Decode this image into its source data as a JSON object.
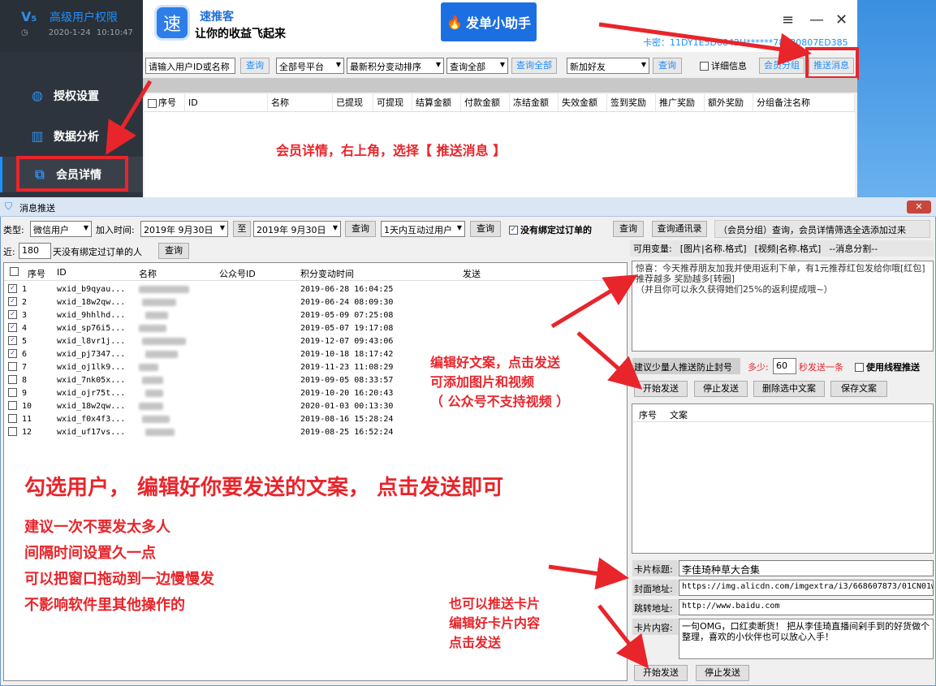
{
  "sidebar": {
    "logo_text": "V₅",
    "title": "高级用户权限",
    "date": "2020-1-24",
    "time": "10:10:47",
    "items": [
      {
        "label": "授权设置",
        "icon": "globe-icon"
      },
      {
        "label": "数据分析",
        "icon": "chart-icon"
      },
      {
        "label": "会员详情",
        "icon": "external-link-icon"
      }
    ]
  },
  "header": {
    "logo_char": "速",
    "app_name": "速推客",
    "slogan": "让你的收益飞起来",
    "helper_button": "发单小助手",
    "card_key": "卡密：11DY1E5D0842H******78630807ED385",
    "menu_icon": "≡",
    "minimize_icon": "—",
    "close_icon": "✕"
  },
  "member_toolbar": {
    "search_placeholder": "请输入用户ID或名称",
    "query_button": "查询",
    "platform_select": "全部号平台",
    "sort_select": "最新积分变动排序",
    "query_all_select": "查询全部",
    "query_all_button": "查询全部",
    "friend_select": "新加好友",
    "query_button2": "查询",
    "detail_checkbox": "详细信息",
    "member_group_button": "会员分组",
    "push_message_button": "推送消息"
  },
  "member_table": {
    "columns": [
      "序号",
      "ID",
      "名称",
      "已提现",
      "可提现",
      "结算金额",
      "付款金额",
      "冻结金额",
      "失效金额",
      "签到奖励",
      "推广奖励",
      "额外奖励",
      "分组备注名称"
    ]
  },
  "annotations": {
    "top": "会员详情，右上角，选择【 推送消息 】",
    "edit_1": "编辑好文案，点击发送",
    "edit_2": "可添加图片和视频",
    "edit_3": "（ 公众号不支持视频 ）",
    "main": "勾选用户，  编辑好你要发送的文案，  点击发送即可",
    "tip_1": "建议一次不要发太多人",
    "tip_2": "间隔时间设置久一点",
    "tip_3": "可以把窗口拖动到一边慢慢发",
    "tip_4": "不影响软件里其他操作的",
    "card_1": "也可以推送卡片",
    "card_2": "编辑好卡片内容",
    "card_3": "点击发送"
  },
  "push_window": {
    "title": "消息推送",
    "close": "✕",
    "type_label": "类型:",
    "type_value": "微信用户",
    "join_time_label": "加入时间:",
    "date_from": "2019年  9月30日",
    "to_label": "至",
    "date_to": "2019年  9月30日",
    "query1": "查询",
    "interaction_select": "1天内互动过用户",
    "query2": "查询",
    "no_order_checkbox": "没有绑定过订单的",
    "query3": "查询",
    "query_contacts": "查询通讯录",
    "info_text": "（会员分组）查询，会员详情筛选全选添加过来",
    "near_label": "近:",
    "near_value": "180",
    "near_suffix": "天没有绑定过订单的人",
    "query4": "查询",
    "vars_label": "可用变量:",
    "vars_1": "[图片|名称.格式]",
    "vars_2": "[视频|名称.格式]",
    "vars_3": "--消息分割--",
    "columns": [
      "序号",
      "ID",
      "名称",
      "公众号ID",
      "积分变动时间",
      "发送"
    ],
    "rows": [
      {
        "no": "1",
        "id": "wxid_b9qyau...",
        "time": "2019-06-28 16:04:25",
        "checked": true
      },
      {
        "no": "2",
        "id": "wxid_18w2qw...",
        "time": "2019-06-24 08:09:30",
        "checked": true
      },
      {
        "no": "3",
        "id": "wxid_9hhlhd...",
        "time": "2019-05-09 07:25:08",
        "checked": true
      },
      {
        "no": "4",
        "id": "wxid_sp76i5...",
        "time": "2019-05-07 19:17:08",
        "checked": true
      },
      {
        "no": "5",
        "id": "wxid_l8vr1j...",
        "time": "2019-12-07 09:43:06",
        "checked": true
      },
      {
        "no": "6",
        "id": "wxid_pj7347...",
        "time": "2019-10-18 18:17:42",
        "checked": true
      },
      {
        "no": "7",
        "id": "wxid_oj1lk9...",
        "time": "2019-11-23 11:08:29",
        "checked": false
      },
      {
        "no": "8",
        "id": "wxid_7nk05x...",
        "time": "2019-09-05 08:33:57",
        "checked": false
      },
      {
        "no": "9",
        "id": "wxid_ojr75t...",
        "time": "2019-10-20 16:20:43",
        "checked": false
      },
      {
        "no": "10",
        "id": "wxid_18w2qw...",
        "time": "2020-01-03 00:13:30",
        "checked": false
      },
      {
        "no": "11",
        "id": "wxid_f0x4f3...",
        "time": "2019-08-16 15:28:24",
        "checked": false
      },
      {
        "no": "12",
        "id": "wxid_uf17vs...",
        "time": "2019-08-25 16:52:24",
        "checked": false
      }
    ],
    "message_text": "惊喜：今天推荐朋友加我并使用返利下单，有1元推荐红包发给你哦[红包]推荐越多 奖励越多[转圈]\n（并且你可以永久获得她们25%的返利提成哦~）",
    "advice_label": "建议少量人推送防止封号",
    "min_label": "多少:",
    "min_value": "60",
    "per_label": "秒发送一条",
    "thread_checkbox": "使用线程推送",
    "start_send": "开始发送",
    "stop_send": "停止发送",
    "delete_selected": "删除选中文案",
    "save_text": "保存文案",
    "list_columns": [
      "序号",
      "文案"
    ],
    "card_title_label": "卡片标题:",
    "card_title_value": "李佳琦种草大合集",
    "cover_label": "封面地址:",
    "cover_value": "https://img.alicdn.com/imgextra/i3/668607873/01CN01w",
    "jump_label": "跳转地址:",
    "jump_value": "http://www.baidu.com",
    "content_label": "卡片内容:",
    "content_value": "一句OMG，口红卖断货！      把从李佳琦直播间剁手到的好货做个整理，喜欢的小伙伴也可以放心入手！",
    "card_start": "开始发送",
    "card_stop": "停止发送"
  }
}
